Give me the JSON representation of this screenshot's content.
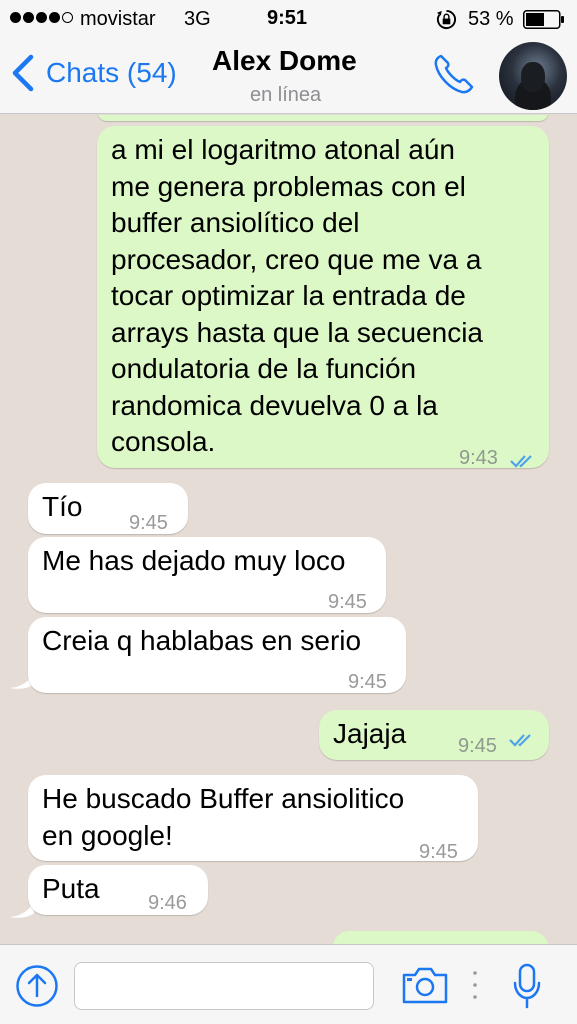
{
  "status_bar": {
    "carrier": "movistar",
    "network": "3G",
    "time": "9:51",
    "battery": "53 %"
  },
  "header": {
    "back_label": "Chats (54)",
    "contact_name": "Alex Dome",
    "contact_status": "en línea",
    "icons": [
      "chevron-left-icon",
      "phone-icon",
      "contact-avatar"
    ]
  },
  "messages": [
    {
      "direction": "outgoing",
      "text": "a mi el logaritmo atonal aún\nme genera problemas con el\nbuffer ansiolítico del\nprocesador, creo que me va a\ntocar optimizar la entrada de\narrays hasta que la secuencia\nondulatoria de la función\nrandomica devuelva 0 a la\nconsola.",
      "time": "9:43",
      "status": "read"
    },
    {
      "direction": "incoming",
      "text": "Tío",
      "time": "9:45"
    },
    {
      "direction": "incoming",
      "text": "Me has dejado muy loco",
      "time": "9:45"
    },
    {
      "direction": "incoming",
      "text": "Creia q hablabas en serio",
      "time": "9:45"
    },
    {
      "direction": "outgoing",
      "text": "Jajaja",
      "time": "9:45",
      "status": "read"
    },
    {
      "direction": "incoming",
      "text": "He buscado Buffer ansiolitico\nen google!",
      "time": "9:45"
    },
    {
      "direction": "incoming",
      "text": "Puta",
      "time": "9:46"
    }
  ],
  "input_bar": {
    "text_value": "",
    "icons": [
      "upload-arrow-icon",
      "camera-icon",
      "microphone-icon"
    ]
  },
  "colors": {
    "accent": "#1b78f2",
    "outgoing_bubble": "#dcf8c6",
    "incoming_bubble": "#ffffff",
    "chat_background": "#e5ddd5",
    "read_ticks": "#4fa3e8"
  }
}
